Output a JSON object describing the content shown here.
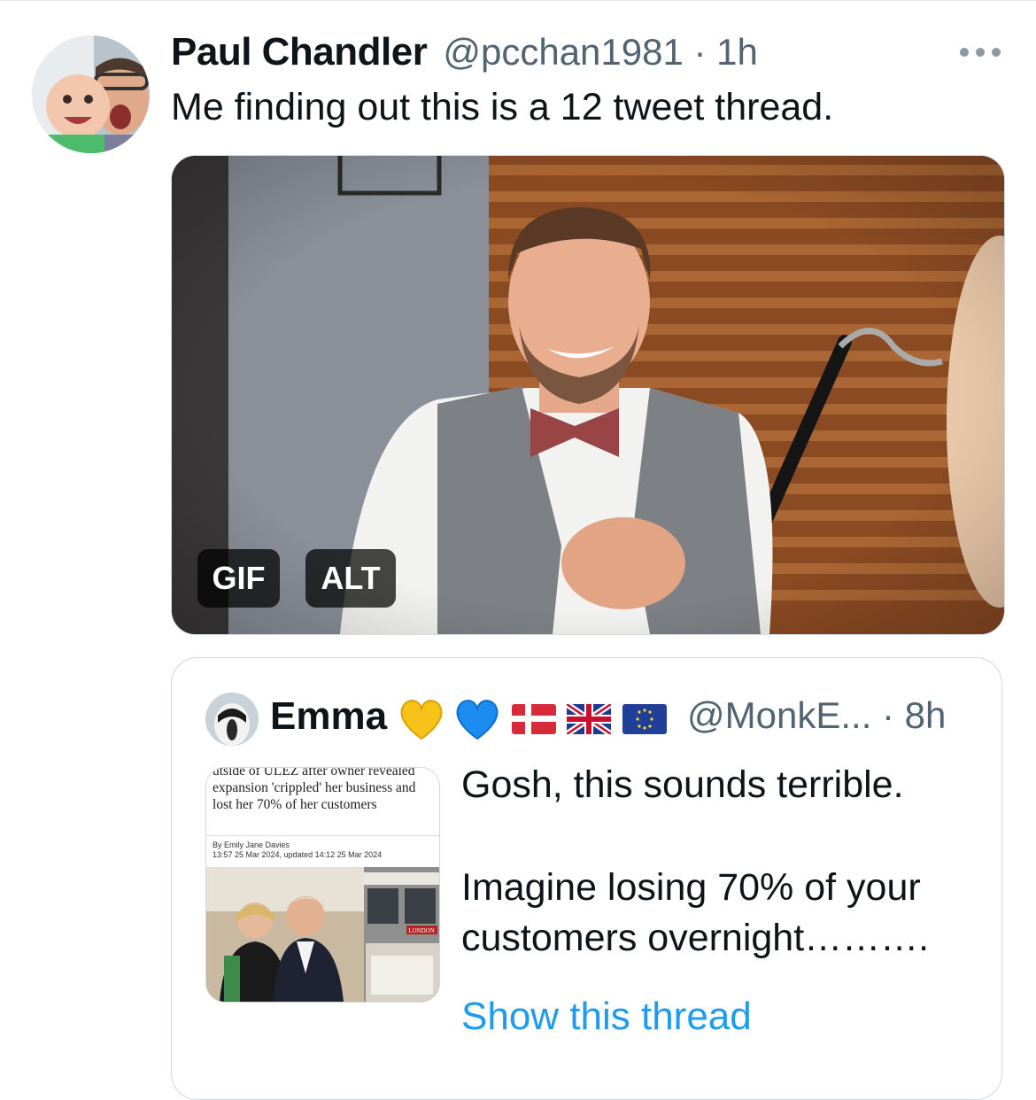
{
  "tweet": {
    "name": "Paul Chandler",
    "handle_time": "@pcchan1981 · 1h",
    "text": "Me finding out this is a 12 tweet thread.",
    "media": {
      "badge_gif": "GIF",
      "badge_alt": "ALT"
    }
  },
  "quote": {
    "name": "Emma",
    "emoji": [
      "yellow-heart",
      "blue-heart",
      "denmark-flag",
      "uk-flag",
      "eu-flag"
    ],
    "handle_time": "@MonkE... · 8h",
    "thumbnail": {
      "headline": "utside of ULEZ after owner revealed expansion 'crippled' her business and lost her 70% of her customers",
      "byline": "By Emily Jane Davies",
      "dateline": "13:57 25 Mar 2024, updated 14:12 25 Mar 2024",
      "shop_sign": "LONDON"
    },
    "text_line1": "Gosh, this sounds terrible.",
    "text_line2": "Imagine losing 70% of your",
    "text_line3": "customers overnight……….",
    "show_thread": "Show this thread"
  },
  "colors": {
    "link": "#1d9bf0",
    "secondary_text": "#536471",
    "border": "#cfd9de"
  }
}
